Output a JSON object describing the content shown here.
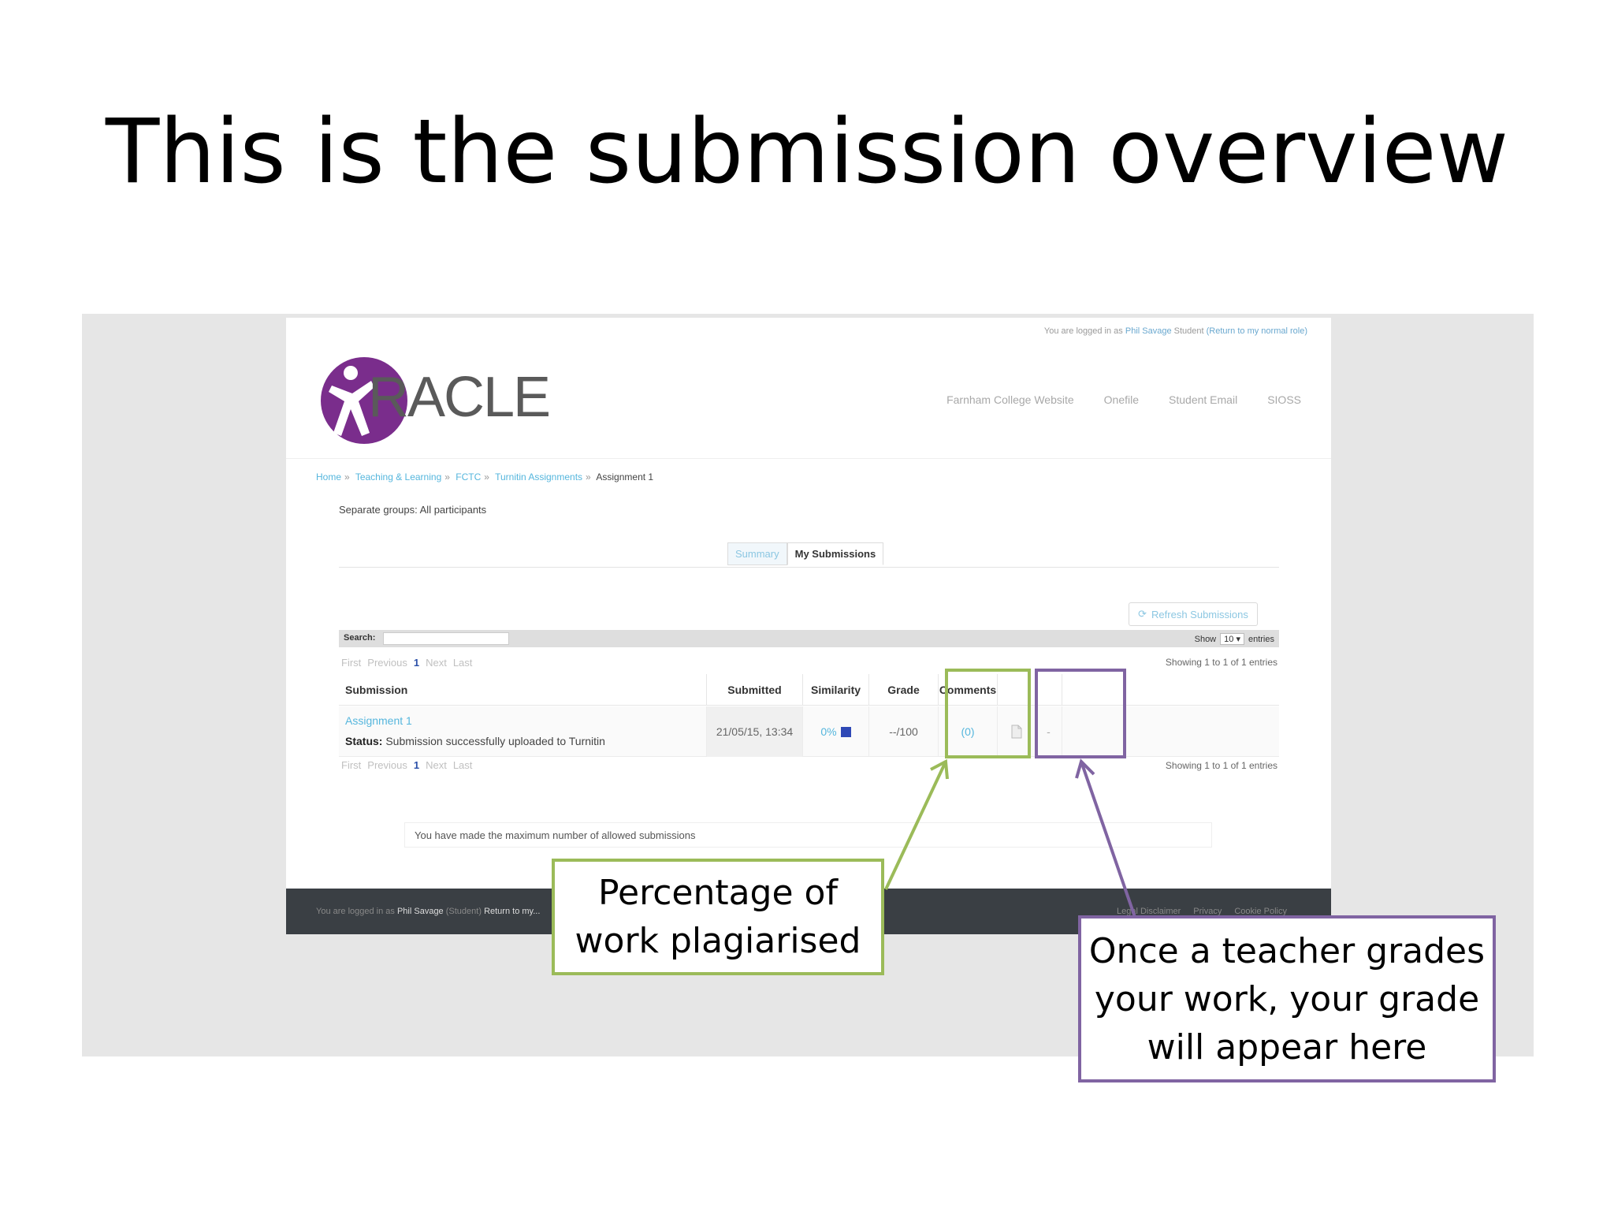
{
  "slide": {
    "title": "This is the submission overview"
  },
  "app": {
    "logged_in_prefix": "You are logged in as",
    "user_name": "Phil Savage",
    "user_role": "Student",
    "return_link": "(Return to my normal role)",
    "logo_text": "RACLE",
    "logo_alt": "ORACLE",
    "nav": [
      "Farnham College Website",
      "Onefile",
      "Student Email",
      "SIOSS"
    ]
  },
  "breadcrumb": [
    "Home",
    "Teaching & Learning",
    "FCTC",
    "Turnitin Assignments",
    "Assignment 1"
  ],
  "groups_label": "Separate groups: All participants",
  "tabs": [
    "Summary",
    "My Submissions"
  ],
  "refresh_label": "Refresh Submissions",
  "search": {
    "label": "Search:",
    "value": ""
  },
  "length": {
    "show": "Show",
    "value": "10",
    "entries": "entries"
  },
  "pager": {
    "first": "First",
    "previous": "Previous",
    "page": "1",
    "next": "Next",
    "last": "Last"
  },
  "showing_text": "Showing 1 to 1 of 1 entries",
  "table": {
    "headers": {
      "submission": "Submission",
      "submitted": "Submitted",
      "similarity": "Similarity",
      "grade": "Grade",
      "comments": "Comments"
    },
    "row": {
      "title": "Assignment 1",
      "status_label": "Status:",
      "status_text": "Submission successfully uploaded to Turnitin",
      "submitted": "21/05/15, 13:34",
      "similarity": "0%",
      "grade": "--/100",
      "comments": "(0)",
      "extra": "-"
    }
  },
  "max_message": "You have made the maximum number of allowed submissions",
  "footer": {
    "prefix": "You are logged in as",
    "user_name": "Phil Savage",
    "role": "(Student)",
    "return_link": "Return to my...",
    "links": [
      "Legal Disclaimer",
      "Privacy",
      "Cookie Policy"
    ]
  },
  "callouts": {
    "similarity": "Percentage of work plagiarised",
    "grade": "Once a teacher grades your work, your grade will appear here"
  },
  "colors": {
    "green_highlight": "#9bbb59",
    "purple_highlight": "#8064a2",
    "logo_purple": "#7a2d8c",
    "link_blue": "#55b6dd",
    "footer_bg": "#3a3f44"
  },
  "icons": [
    "refresh-icon",
    "file-icon"
  ]
}
